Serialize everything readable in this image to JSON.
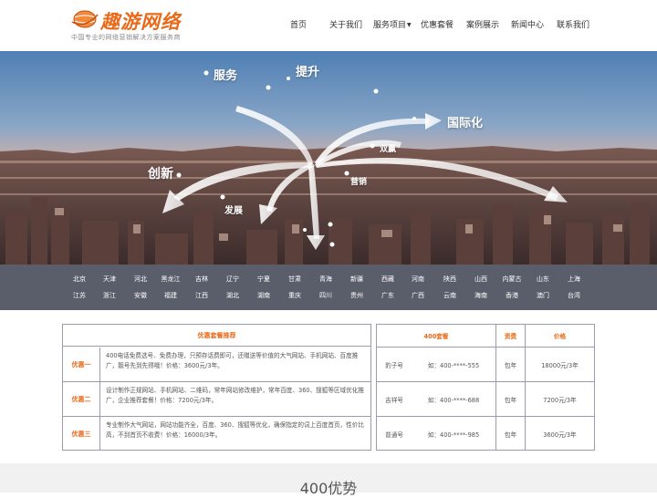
{
  "brand": {
    "logo_text": "趣游网络",
    "tagline": "中国专业的网络营销解决方案服务商",
    "accent": "#e86a1a"
  },
  "nav": {
    "items": [
      {
        "label": "首页"
      },
      {
        "label": "关于我们"
      },
      {
        "label": "服务项目"
      },
      {
        "label": "优惠套餐"
      },
      {
        "label": "案例展示"
      },
      {
        "label": "新闻中心"
      },
      {
        "label": "联系我们"
      }
    ]
  },
  "hero": {
    "labels": [
      "服务",
      "提升",
      "国际化",
      "创新",
      "发展",
      "双赢",
      "营销"
    ]
  },
  "regions": {
    "row1": [
      "北京",
      "天津",
      "河北",
      "黑龙江",
      "吉林",
      "辽宁",
      "宁夏",
      "甘肃",
      "青海",
      "新疆",
      "西藏",
      "河南",
      "陕西",
      "山西",
      "内蒙古",
      "山东",
      "上海"
    ],
    "row2": [
      "江苏",
      "浙江",
      "安徽",
      "福建",
      "江西",
      "湖北",
      "湖南",
      "重庆",
      "四川",
      "贵州",
      "广东",
      "广西",
      "云南",
      "海南",
      "香港",
      "澳门",
      "台湾"
    ]
  },
  "packages": {
    "title": "优惠套餐推荐",
    "items": [
      {
        "name": "优惠一",
        "desc": "400电话免费选号、免费办理，只预存话费即可，还赠送等价值的大气网站、手机网站、百度推广，靓号先到先得哦！价格：3600元/3年。"
      },
      {
        "name": "优惠二",
        "desc": "设计制作正规网站、手机网站、二维码，常年网站修改维护，常年百度、360、搜狐等区域优化推广，企业推荐套餐！价格：7200元/3年。"
      },
      {
        "name": "优惠三",
        "desc": "专业制作大气网站，网站功能齐全，百度、360、搜狐等优化，确保指定的词上百度首页，性价比高，不到首页不收费！价格：16000/3年。"
      }
    ]
  },
  "pricing": {
    "headers": [
      "400套餐",
      "资费",
      "价格"
    ],
    "rows": [
      {
        "name": "豹子号",
        "number": "如：400-****-555",
        "fee": "包年",
        "price": "18000元/3年"
      },
      {
        "name": "吉祥号",
        "number": "如：400-****-688",
        "fee": "包年",
        "price": "7200元/3年"
      },
      {
        "name": "普通号",
        "number": "如：400-****-985",
        "fee": "包年",
        "price": "3600元/3年"
      }
    ]
  },
  "advantage": {
    "title": "400优势"
  }
}
